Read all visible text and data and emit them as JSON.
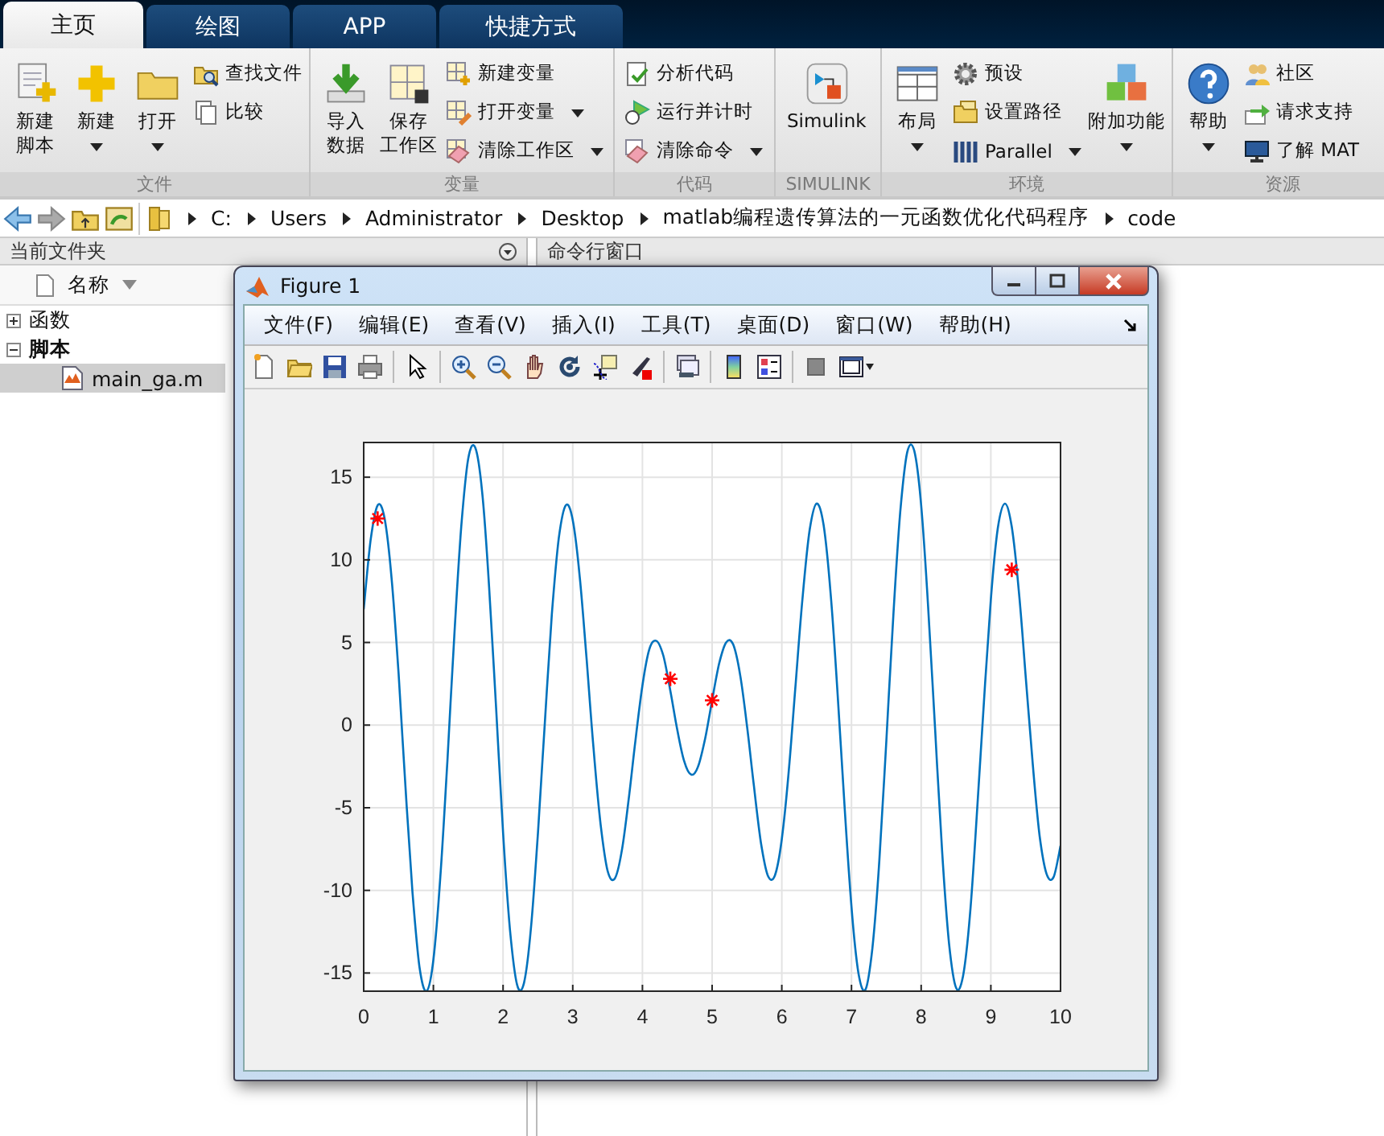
{
  "tabs": [
    {
      "label": "主页",
      "selected": true
    },
    {
      "label": "绘图",
      "selected": false
    },
    {
      "label": "APP",
      "selected": false
    },
    {
      "label": "快捷方式",
      "selected": false
    }
  ],
  "ribbon": [
    {
      "label": "文件",
      "columns": [
        {
          "kind": "large",
          "lines": [
            "新建",
            "脚本"
          ],
          "dropdown": false
        },
        {
          "kind": "large",
          "lines": [
            "新建"
          ],
          "dropdown": true
        },
        {
          "kind": "large",
          "lines": [
            "打开"
          ],
          "dropdown": true
        },
        {
          "kind": "stack",
          "items": [
            {
              "label": "查找文件",
              "dropdown": false
            },
            {
              "label": "比较",
              "dropdown": false
            }
          ]
        }
      ]
    },
    {
      "label": "变量",
      "columns": [
        {
          "kind": "large",
          "lines": [
            "导入",
            "数据"
          ],
          "dropdown": false
        },
        {
          "kind": "large",
          "lines": [
            "保存",
            "工作区"
          ],
          "dropdown": false
        },
        {
          "kind": "stack",
          "items": [
            {
              "label": "新建变量",
              "dropdown": false
            },
            {
              "label": "打开变量",
              "dropdown": true
            },
            {
              "label": "清除工作区",
              "dropdown": true
            }
          ]
        }
      ]
    },
    {
      "label": "代码",
      "columns": [
        {
          "kind": "stack",
          "items": [
            {
              "label": "分析代码",
              "dropdown": false
            },
            {
              "label": "运行并计时",
              "dropdown": false
            },
            {
              "label": "清除命令",
              "dropdown": true
            }
          ]
        }
      ]
    },
    {
      "label": "SIMULINK",
      "columns": [
        {
          "kind": "large",
          "lines": [
            "Simulink"
          ],
          "dropdown": false
        }
      ]
    },
    {
      "label": "环境",
      "columns": [
        {
          "kind": "large",
          "lines": [
            "布局"
          ],
          "dropdown": true
        },
        {
          "kind": "stack",
          "items": [
            {
              "label": "预设",
              "dropdown": false
            },
            {
              "label": "设置路径",
              "dropdown": false
            },
            {
              "label": "Parallel",
              "dropdown": true
            }
          ]
        },
        {
          "kind": "large",
          "lines": [
            "附加功能"
          ],
          "dropdown": true
        }
      ]
    },
    {
      "label": "资源",
      "columns": [
        {
          "kind": "large",
          "lines": [
            "帮助"
          ],
          "dropdown": true
        },
        {
          "kind": "stack",
          "items": [
            {
              "label": "社区",
              "dropdown": false
            },
            {
              "label": "请求支持",
              "dropdown": false
            },
            {
              "label": "了解 MAT",
              "dropdown": false
            }
          ]
        }
      ]
    }
  ],
  "address": {
    "crumbs": [
      "C:",
      "Users",
      "Administrator",
      "Desktop",
      "matlab编程遗传算法的一元函数优化代码程序",
      "code"
    ]
  },
  "current_folder": {
    "title": "当前文件夹",
    "column": "名称",
    "tree": [
      {
        "label": "函数",
        "expanded": false,
        "selected": false
      },
      {
        "label": "脚本",
        "expanded": true,
        "selected": false,
        "children": [
          {
            "label": "main_ga.m",
            "selected": true
          }
        ]
      }
    ]
  },
  "command_window": {
    "title": "命令行窗口"
  },
  "figure": {
    "title": "Figure 1",
    "menu": [
      "文件(F)",
      "编辑(E)",
      "查看(V)",
      "插入(I)",
      "工具(T)",
      "桌面(D)",
      "窗口(W)",
      "帮助(H)"
    ],
    "chart_data": {
      "type": "line",
      "grid": true,
      "xlim": [
        0,
        10
      ],
      "ylim": [
        -16.1,
        17.1
      ],
      "xticks": [
        0,
        1,
        2,
        3,
        4,
        5,
        6,
        7,
        8,
        9,
        10
      ],
      "yticks": [
        -15,
        -10,
        -5,
        0,
        5,
        10,
        15
      ],
      "x": [
        0,
        0.1,
        0.2,
        0.3,
        0.4,
        0.5,
        0.6,
        0.7,
        0.8,
        0.9,
        1,
        1.1,
        1.2,
        1.3,
        1.4,
        1.5,
        1.6,
        1.7,
        1.8,
        1.9,
        2,
        2.1,
        2.2,
        2.3,
        2.4,
        2.5,
        2.6,
        2.7,
        2.8,
        2.9,
        3,
        3.1,
        3.2,
        3.3,
        3.4,
        3.5,
        3.6,
        3.7,
        3.8,
        3.9,
        4,
        4.1,
        4.2,
        4.3,
        4.4,
        4.5,
        4.6,
        4.7,
        4.8,
        4.9,
        5,
        5.1,
        5.2,
        5.3,
        5.4,
        5.5,
        5.6,
        5.7,
        5.8,
        5.9,
        6,
        6.1,
        6.2,
        6.3,
        6.4,
        6.5,
        6.6,
        6.7,
        6.8,
        6.9,
        7,
        7.1,
        7.2,
        7.3,
        7.4,
        7.5,
        7.6,
        7.7,
        7.8,
        7.9,
        8,
        8.1,
        8.2,
        8.3,
        8.4,
        8.5,
        8.6,
        8.7,
        8.8,
        8.9,
        9,
        9.1,
        9.2,
        9.3,
        9.4,
        9.5,
        9.6,
        9.7,
        9.8,
        9.9,
        10
      ],
      "series": [
        {
          "type": "line",
          "color": "#0072bd",
          "values": [
            7.0,
            11.2,
            13.3,
            12.5,
            8.9,
            3.1,
            -3.8,
            -10.1,
            -14.6,
            -16.1,
            -14.2,
            -9.2,
            -2.2,
            5.4,
            12.0,
            16.1,
            16.8,
            14.1,
            8.4,
            1.0,
            -6.5,
            -12.4,
            -15.7,
            -15.6,
            -12.3,
            -6.5,
            0.2,
            6.7,
            11.3,
            13.3,
            12.4,
            9.0,
            3.9,
            -1.5,
            -6.0,
            -8.8,
            -9.3,
            -7.7,
            -4.6,
            -0.9,
            2.4,
            4.6,
            5.1,
            4.2,
            2.1,
            -0.3,
            -2.2,
            -3.0,
            -2.5,
            -0.8,
            1.5,
            3.7,
            5.0,
            4.9,
            3.1,
            0.0,
            -3.7,
            -7.1,
            -9.1,
            -9.1,
            -6.9,
            -2.8,
            2.6,
            7.8,
            11.8,
            13.4,
            12.1,
            8.0,
            2.0,
            -4.9,
            -11.0,
            -15.0,
            -16.0,
            -13.5,
            -8.2,
            -0.9,
            6.6,
            12.9,
            16.5,
            16.6,
            13.3,
            7.2,
            -0.3,
            -7.6,
            -13.2,
            -15.9,
            -15.2,
            -11.5,
            -5.4,
            1.4,
            7.6,
            11.9,
            13.4,
            12.0,
            8.2,
            3.0,
            -2.3,
            -6.7,
            -9.0,
            -9.2,
            -7.3
          ]
        },
        {
          "type": "scatter",
          "color": "#ff0000",
          "values": [
            null,
            null,
            12.5,
            null,
            null,
            null,
            null,
            null,
            null,
            null,
            null,
            null,
            null,
            null,
            null,
            null,
            null,
            null,
            null,
            null,
            null,
            null,
            null,
            null,
            null,
            null,
            null,
            null,
            null,
            null,
            null,
            null,
            null,
            null,
            null,
            null,
            null,
            null,
            null,
            null,
            null,
            null,
            null,
            null,
            2.8,
            null,
            null,
            null,
            null,
            null,
            1.5,
            null,
            null,
            null,
            null,
            null,
            null,
            null,
            null,
            null,
            null,
            null,
            null,
            null,
            null,
            null,
            null,
            null,
            null,
            null,
            null,
            null,
            null,
            null,
            null,
            null,
            null,
            null,
            null,
            null,
            null,
            null,
            null,
            null,
            null,
            null,
            null,
            null,
            null,
            null,
            null,
            null,
            null,
            9.4,
            null,
            null,
            null,
            null,
            null,
            null,
            null
          ]
        }
      ]
    }
  }
}
